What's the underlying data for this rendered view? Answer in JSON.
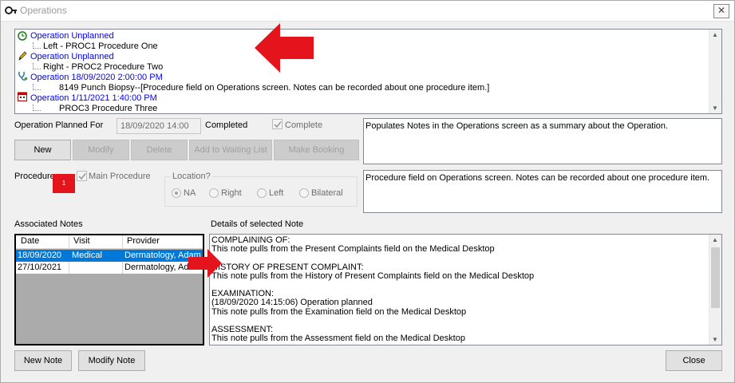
{
  "window": {
    "title": "Operations",
    "close_glyph": "✕"
  },
  "tree": {
    "items": [
      {
        "header": "Operation Unplanned",
        "icon": "clock-icon",
        "detail": "Left  - PROC1  Procedure One"
      },
      {
        "header": "Operation Unplanned",
        "icon": "pencil-icon",
        "detail": "Right - PROC2  Procedure Two"
      },
      {
        "header": "Operation 18/09/2020 2:00:00 PM",
        "icon": "stethoscope-icon",
        "detail": "8149  Punch Biopsy--[Procedure field on Operations screen. Notes can be recorded about one procedure item.]"
      },
      {
        "header": "Operation 1/11/2021 1:40:00 PM",
        "icon": "calendar-icon",
        "detail": "PROC3  Procedure Three"
      }
    ]
  },
  "operation": {
    "planned_for_label": "Operation Planned For",
    "planned_for_value": "18/09/2020 14:00",
    "completed_label": "Completed",
    "complete_checkbox_label": "Complete",
    "summary_notes": "Populates Notes in the Operations screen as a summary about the Operation."
  },
  "toolbar": {
    "new": "New",
    "modify": "Modify",
    "delete": "Delete",
    "add_waiting": "Add to Waiting List",
    "make_booking": "Make Booking"
  },
  "procedure": {
    "label": "Procedure",
    "main_procedure_label": "Main Procedure",
    "location_label": "Location?",
    "locations": [
      "NA",
      "Right",
      "Left",
      "Bilateral"
    ],
    "selected_location": "NA",
    "notes": "Procedure field on Operations screen. Notes can be recorded about one procedure item."
  },
  "annotation": {
    "badge": "1",
    "color": "#e3141b"
  },
  "associated_notes": {
    "label": "Associated Notes",
    "columns": [
      "Date",
      "Visit",
      "Provider"
    ],
    "rows": [
      {
        "date": "18/09/2020",
        "visit": "Medical",
        "provider": "Dermatology, Adam"
      },
      {
        "date": "27/10/2021",
        "visit": "",
        "provider": "Dermatology, Adam"
      }
    ]
  },
  "details": {
    "label": "Details of selected Note",
    "lines": [
      "COMPLAINING OF:",
      "This note pulls from the Present Complaints field on the Medical Desktop",
      "",
      "HISTORY OF PRESENT COMPLAINT:",
      "This note pulls from the History of Present Complaints field on the Medical Desktop",
      "",
      "EXAMINATION:",
      "(18/09/2020 14:15:06) Operation planned",
      "This note pulls from the Examination field on the Medical Desktop",
      "",
      "ASSESSMENT:",
      "This note pulls from the Assessment field on the Medical Desktop"
    ]
  },
  "footer": {
    "new_note": "New Note",
    "modify_note": "Modify Note",
    "close": "Close"
  },
  "colors": {
    "selection": "#0078d7",
    "link_blue": "#0000ff",
    "arrow_red": "#e3141b"
  }
}
